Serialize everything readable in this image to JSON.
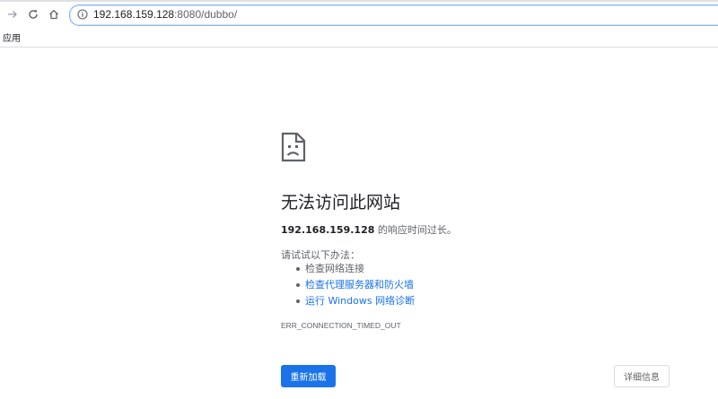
{
  "browser": {
    "url": "192.168.159.128",
    "url_port_path": ":8080/dubbo/",
    "bookmarks": [
      {
        "label": "应用",
        "icon": "apps-grid-icon"
      }
    ],
    "icons": {
      "forward": "arrow-forward-icon",
      "reload": "reload-icon",
      "home": "home-icon",
      "info": "info-icon"
    }
  },
  "error_page": {
    "icon": "sad-document-icon",
    "title": "无法访问此网站",
    "host": "192.168.159.128",
    "summary_suffix": " 的响应时间过长。",
    "try_label": "请试试以下办法：",
    "suggestions": [
      {
        "label": "检查网络连接",
        "link": false
      },
      {
        "label": "检查代理服务器和防火墙",
        "link": true
      },
      {
        "label": "运行 Windows 网络诊断",
        "link": true
      }
    ],
    "error_code": "ERR_CONNECTION_TIMED_OUT",
    "reload_label": "重新加载",
    "details_label": "详细信息"
  },
  "colors": {
    "accent": "#1a73e8",
    "text_secondary": "#5f6368",
    "text_primary": "#202124"
  }
}
